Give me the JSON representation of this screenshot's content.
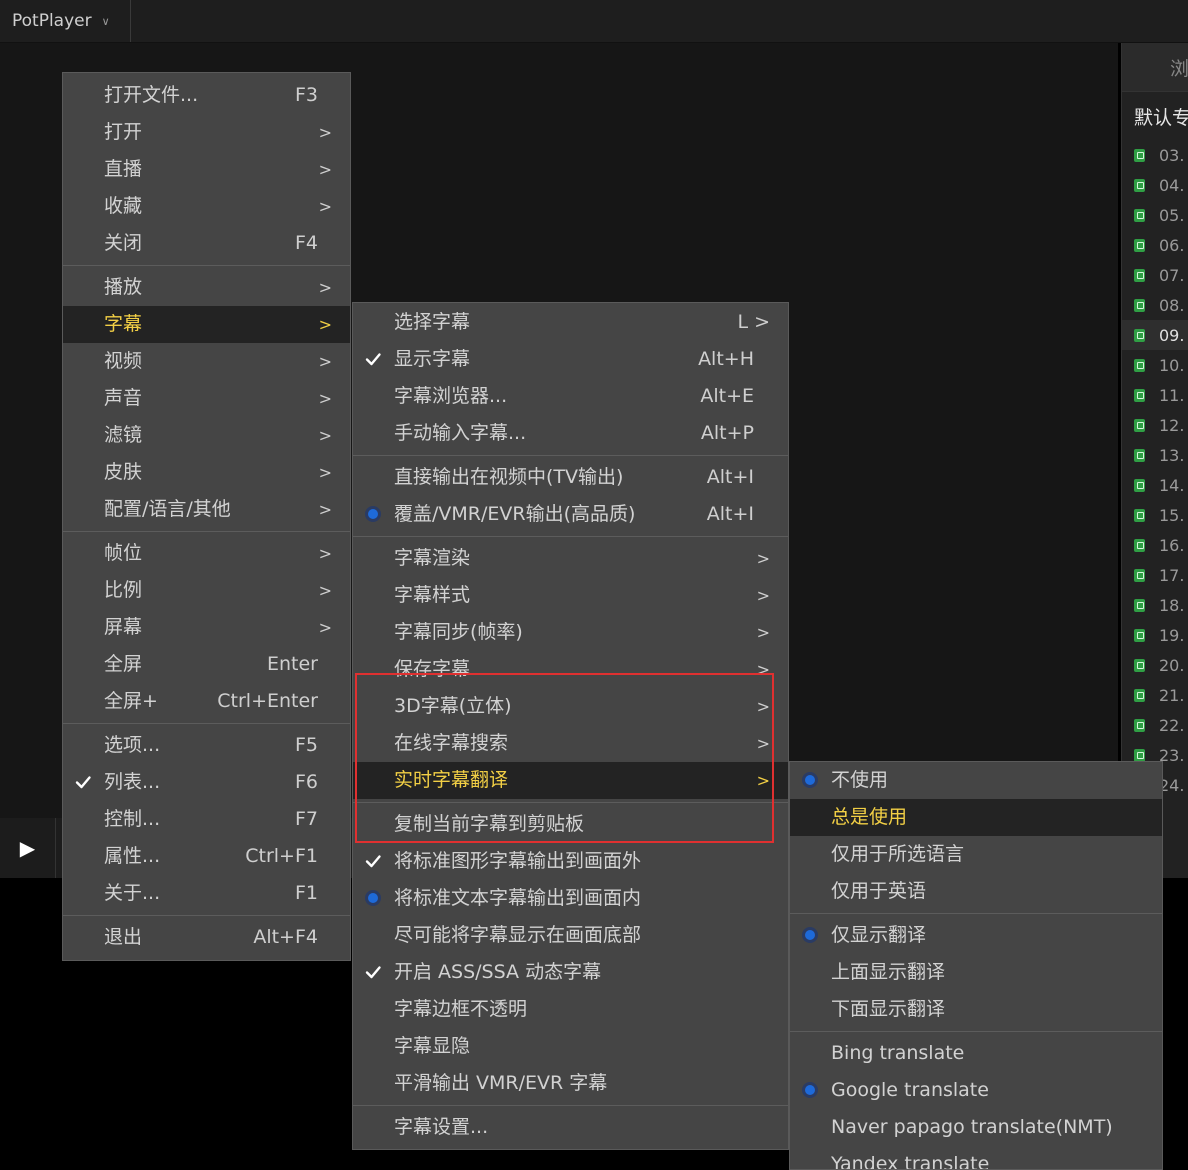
{
  "app": {
    "title": "PotPlayer"
  },
  "playlist": {
    "tab_label": "浏",
    "title": "默认专",
    "items": [
      "03.",
      "04.",
      "05.",
      "06.",
      "07.",
      "08.",
      "09.",
      "10.",
      "11.",
      "12.",
      "13.",
      "14.",
      "15.",
      "16.",
      "17.",
      "18.",
      "19.",
      "20.",
      "21.",
      "22.",
      "23.",
      "24."
    ],
    "current_index": 6
  },
  "main_menu": {
    "items": [
      {
        "label": "打开文件...",
        "shortcut": "F3"
      },
      {
        "label": "打开",
        "arrow": ">"
      },
      {
        "label": "直播",
        "arrow": ">"
      },
      {
        "label": "收藏",
        "arrow": ">"
      },
      {
        "label": "关闭",
        "shortcut": "F4"
      },
      {
        "label": "播放",
        "arrow": ">"
      },
      {
        "label": "字幕",
        "arrow": ">"
      },
      {
        "label": "视频",
        "arrow": ">"
      },
      {
        "label": "声音",
        "arrow": ">"
      },
      {
        "label": "滤镜",
        "arrow": ">"
      },
      {
        "label": "皮肤",
        "arrow": ">"
      },
      {
        "label": "配置/语言/其他",
        "arrow": ">"
      },
      {
        "label": "帧位",
        "arrow": ">"
      },
      {
        "label": "比例",
        "arrow": ">"
      },
      {
        "label": "屏幕",
        "arrow": ">"
      },
      {
        "label": "全屏",
        "shortcut": "Enter"
      },
      {
        "label": "全屏+",
        "shortcut": "Ctrl+Enter"
      },
      {
        "label": "选项...",
        "shortcut": "F5"
      },
      {
        "label": "列表...",
        "shortcut": "F6"
      },
      {
        "label": "控制...",
        "shortcut": "F7"
      },
      {
        "label": "属性...",
        "shortcut": "Ctrl+F1"
      },
      {
        "label": "关于...",
        "shortcut": "F1"
      },
      {
        "label": "退出",
        "shortcut": "Alt+F4"
      }
    ]
  },
  "subtitle_menu": {
    "items": [
      {
        "label": "选择字幕",
        "shortcut": "L >"
      },
      {
        "label": "显示字幕",
        "shortcut": "Alt+H"
      },
      {
        "label": "字幕浏览器...",
        "shortcut": "Alt+E"
      },
      {
        "label": "手动输入字幕...",
        "shortcut": "Alt+P"
      },
      {
        "label": "直接输出在视频中(TV输出)",
        "shortcut": "Alt+I"
      },
      {
        "label": "覆盖/VMR/EVR输出(高品质)",
        "shortcut": "Alt+I"
      },
      {
        "label": "字幕渲染",
        "arrow": ">"
      },
      {
        "label": "字幕样式",
        "arrow": ">"
      },
      {
        "label": "字幕同步(帧率)",
        "arrow": ">"
      },
      {
        "label": "保存字幕",
        "arrow": ">"
      },
      {
        "label": "3D字幕(立体)",
        "arrow": ">"
      },
      {
        "label": "在线字幕搜索",
        "arrow": ">"
      },
      {
        "label": "实时字幕翻译",
        "arrow": ">"
      },
      {
        "label": "复制当前字幕到剪贴板"
      },
      {
        "label": "将标准图形字幕输出到画面外"
      },
      {
        "label": "将标准文本字幕输出到画面内"
      },
      {
        "label": "尽可能将字幕显示在画面底部"
      },
      {
        "label": "开启 ASS/SSA 动态字幕"
      },
      {
        "label": "字幕边框不透明"
      },
      {
        "label": "字幕显隐"
      },
      {
        "label": "平滑输出 VMR/EVR 字幕"
      },
      {
        "label": "字幕设置..."
      }
    ]
  },
  "translate_menu": {
    "items": [
      {
        "label": "不使用"
      },
      {
        "label": "总是使用"
      },
      {
        "label": "仅用于所选语言"
      },
      {
        "label": "仅用于英语"
      },
      {
        "label": "仅显示翻译"
      },
      {
        "label": "上面显示翻译"
      },
      {
        "label": "下面显示翻译"
      },
      {
        "label": "Bing translate"
      },
      {
        "label": "Google translate"
      },
      {
        "label": "Naver papago translate(NMT)"
      },
      {
        "label": "Yandex translate"
      }
    ]
  },
  "colors": {
    "menu_bg": "#454545",
    "highlight_bg": "#232323",
    "highlight_text": "#f2cf45",
    "radio": "#1e6ad9",
    "annotation_box": "#e03030"
  }
}
